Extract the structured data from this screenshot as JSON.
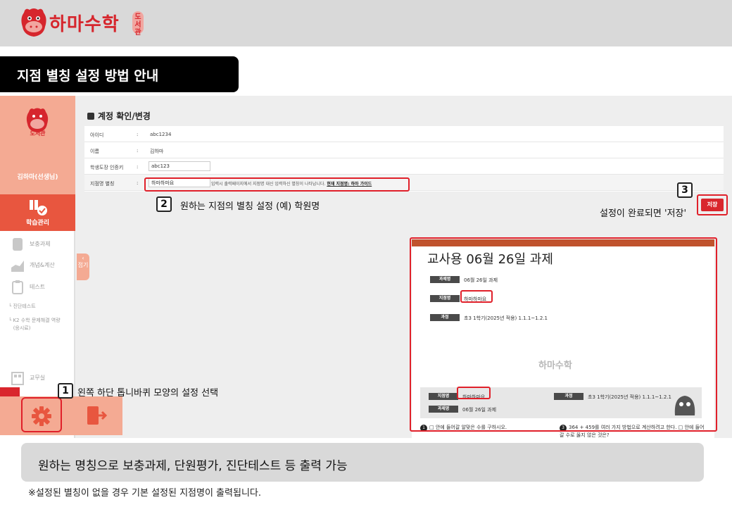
{
  "colors": {
    "brand_red": "#d6262d",
    "sidebar_peach": "#f4aa93",
    "sidebar_active": "#e8563f"
  },
  "header": {
    "logo_text": "하마수학",
    "logo_badge": "도서관"
  },
  "title_bar": {
    "title": "지점 별칭 설정 방법 안내"
  },
  "sidebar": {
    "logo_text": "도서관",
    "user_name": "김하마(선생님)",
    "active_item": {
      "label": "학습관리",
      "icon": "study-icon"
    },
    "items": [
      {
        "label": "보충과제",
        "icon": "hand-icon"
      },
      {
        "label": "개념&계산",
        "icon": "chart-icon"
      },
      {
        "label": "테스트",
        "icon": "clipboard-icon"
      },
      {
        "label": "교무실",
        "icon": "office-icon"
      }
    ],
    "sub_items": [
      "진단테스트",
      "K2 수학 문제해결 역량",
      "(응시료)"
    ],
    "collapse_label": "접기"
  },
  "account": {
    "title": "계정 확인/변경",
    "rows": [
      {
        "label": "아이디",
        "value": "abc1234"
      },
      {
        "label": "이름",
        "value": "김하마"
      },
      {
        "label": "학생도장 인증키",
        "value": "abc123"
      },
      {
        "label": "지점명 별칭",
        "value": "하마하마요",
        "desc": "입력시 출력페이지에서 지점명 대신 입력하신 별칭이 나타납니다.",
        "link": "현재 지점명: 하마 가이드"
      }
    ],
    "separator": ":",
    "save_label": "저장"
  },
  "steps": [
    {
      "num": "1",
      "text": "왼쪽 하단 톱니바퀴 모양의 설정 선택"
    },
    {
      "num": "2",
      "text": "원하는 지점의 별칭 설정 (예) 학원명"
    },
    {
      "num": "3",
      "text": "설정이 완료되면 '저장'"
    }
  ],
  "preview": {
    "title": "교사용 06월 26일 과제",
    "fields": [
      {
        "tag": "과제명",
        "value": "06월 26일 과제"
      },
      {
        "tag": "지점명",
        "value": "하마하마요"
      },
      {
        "tag": "과정",
        "value": "초3 1학기(2025년 적용) 1.1.1~1.2.1"
      }
    ],
    "watermark": "하마수학",
    "footer": {
      "branch_tag": "지점명",
      "branch_value": "하마하마요",
      "course_tag": "과정",
      "course_value": "초3 1학기(2025년 적용) 1.1.1~1.2.1",
      "task_tag": "과제명",
      "task_value": "06월 26일 과제"
    },
    "questions": [
      {
        "num": "1",
        "text": "□ 안에 들어갈 알맞은 수를 구하시오."
      },
      {
        "num": "3",
        "text": "364 + 459를 여러 가지 방법으로 계산하려고 한다. □ 안에 들어갈 수로 옳지 않은 것은?"
      }
    ]
  },
  "notes": {
    "main": "원하는 명칭으로 보충과제, 단원평가, 진단테스트 등 출력 가능",
    "footnote": "※설정된 별칭이 없을 경우 기본 설정된 지점명이 출력됩니다."
  }
}
